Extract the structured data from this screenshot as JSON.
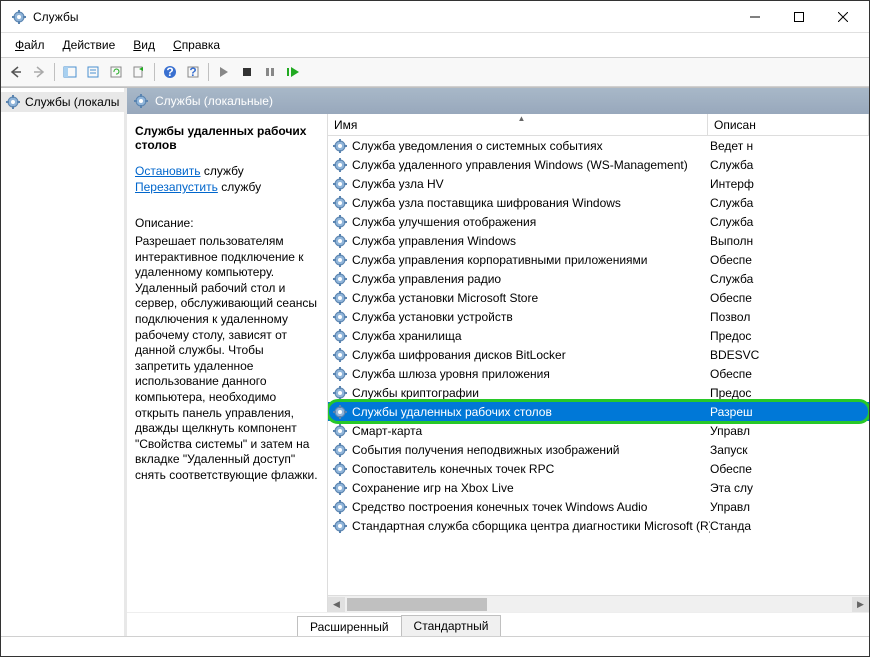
{
  "window": {
    "title": "Службы"
  },
  "menu": {
    "file": "Файл",
    "action": "Действие",
    "view": "Вид",
    "help": "Справка"
  },
  "tree": {
    "root": "Службы (локалы"
  },
  "header": {
    "label": "Службы (локальные)"
  },
  "detail": {
    "item_name": "Службы удаленных рабочих столов",
    "stop": "Остановить",
    "stop_suffix": " службу",
    "restart": "Перезапустить",
    "restart_suffix": " службу",
    "desc_label": "Описание:",
    "desc_text": "Разрешает пользователям интерактивное подключение к удаленному компьютеру. Удаленный рабочий стол и сервер, обслуживающий сеансы подключения к удаленному рабочему столу, зависят от данной службы.  Чтобы запретить удаленное использование данного компьютера, необходимо открыть панель управления, дважды щелкнуть компонент \"Свойства системы\" и затем на вкладке \"Удаленный доступ\" снять соответствующие флажки."
  },
  "columns": {
    "name": "Имя",
    "desc": "Описан"
  },
  "services": [
    {
      "name": "Служба уведомления о системных событиях",
      "desc": "Ведет н"
    },
    {
      "name": "Служба удаленного управления Windows (WS-Management)",
      "desc": "Служба"
    },
    {
      "name": "Служба узла HV",
      "desc": "Интерф"
    },
    {
      "name": "Служба узла поставщика шифрования Windows",
      "desc": "Служба"
    },
    {
      "name": "Служба улучшения отображения",
      "desc": "Служба"
    },
    {
      "name": "Служба управления Windows",
      "desc": "Выполн"
    },
    {
      "name": "Служба управления корпоративными приложениями",
      "desc": "Обеспе"
    },
    {
      "name": "Служба управления радио",
      "desc": "Служба"
    },
    {
      "name": "Служба установки Microsoft Store",
      "desc": "Обеспе"
    },
    {
      "name": "Служба установки устройств",
      "desc": "Позвол"
    },
    {
      "name": "Служба хранилища",
      "desc": "Предос"
    },
    {
      "name": "Служба шифрования дисков BitLocker",
      "desc": "BDESVC"
    },
    {
      "name": "Служба шлюза уровня приложения",
      "desc": "Обеспе"
    },
    {
      "name": "Службы криптографии",
      "desc": "Предос"
    },
    {
      "name": "Службы удаленных рабочих столов",
      "desc": "Разреш",
      "selected": true
    },
    {
      "name": "Смарт-карта",
      "desc": "Управл"
    },
    {
      "name": "События получения неподвижных изображений",
      "desc": "Запуск"
    },
    {
      "name": "Сопоставитель конечных точек RPC",
      "desc": "Обеспе"
    },
    {
      "name": "Сохранение игр на Xbox Live",
      "desc": "Эта слу"
    },
    {
      "name": "Средство построения конечных точек Windows Audio",
      "desc": "Управл"
    },
    {
      "name": "Стандартная служба сборщика центра диагностики Microsoft (R)",
      "desc": "Станда"
    }
  ],
  "tabs": {
    "extended": "Расширенный",
    "standard": "Стандартный"
  }
}
